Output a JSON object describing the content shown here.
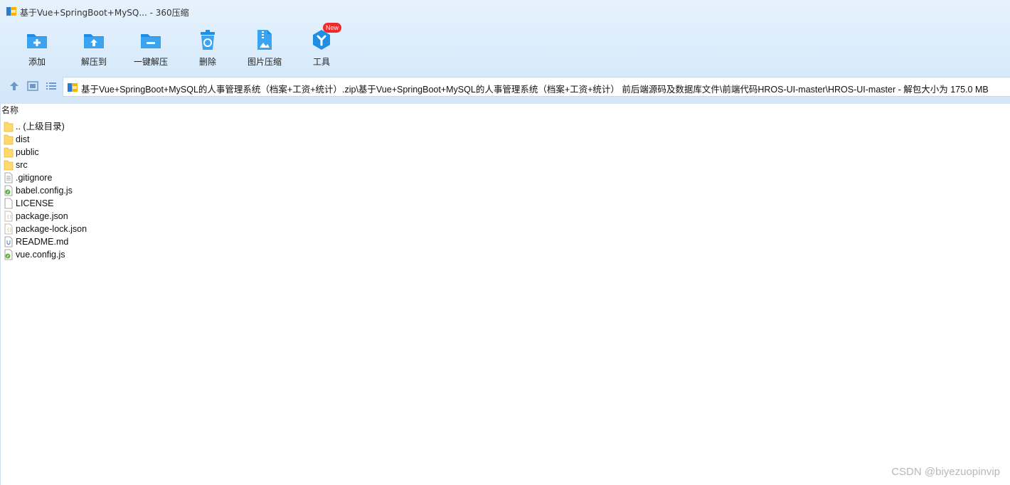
{
  "window": {
    "title": "基于Vue+SpringBoot+MySQ... - 360压缩"
  },
  "toolbar": {
    "items": [
      {
        "label": "添加",
        "icon": "add-folder-icon"
      },
      {
        "label": "解压到",
        "icon": "extract-to-icon"
      },
      {
        "label": "一键解压",
        "icon": "one-click-extract-icon"
      },
      {
        "label": "删除",
        "icon": "trash-icon"
      },
      {
        "label": "图片压缩",
        "icon": "image-compress-icon"
      },
      {
        "label": "工具",
        "icon": "tools-icon",
        "badge": "New"
      }
    ]
  },
  "nav": {
    "path": "基于Vue+SpringBoot+MySQL的人事管理系统（档案+工资+统计）.zip\\基于Vue+SpringBoot+MySQL的人事管理系统（档案+工资+统计） 前后端源码及数据库文件\\前端代码HROS-UI-master\\HROS-UI-master - 解包大小为 175.0 MB"
  },
  "list": {
    "column_name": "名称",
    "files": [
      {
        "name": ".. (上级目录)",
        "type": "folder"
      },
      {
        "name": "dist",
        "type": "folder"
      },
      {
        "name": "public",
        "type": "folder"
      },
      {
        "name": "src",
        "type": "folder"
      },
      {
        "name": ".gitignore",
        "type": "text"
      },
      {
        "name": "babel.config.js",
        "type": "js"
      },
      {
        "name": "LICENSE",
        "type": "blank"
      },
      {
        "name": "package.json",
        "type": "json"
      },
      {
        "name": "package-lock.json",
        "type": "json"
      },
      {
        "name": "README.md",
        "type": "md"
      },
      {
        "name": "vue.config.js",
        "type": "js"
      }
    ]
  },
  "watermark": "CSDN @biyezuopinvip",
  "colors": {
    "toolbar_bg": "#d9ebfb",
    "icon_blue": "#1f8fe6",
    "folder_yellow": "#ffd96b",
    "badge_red": "#ee2a2a"
  }
}
